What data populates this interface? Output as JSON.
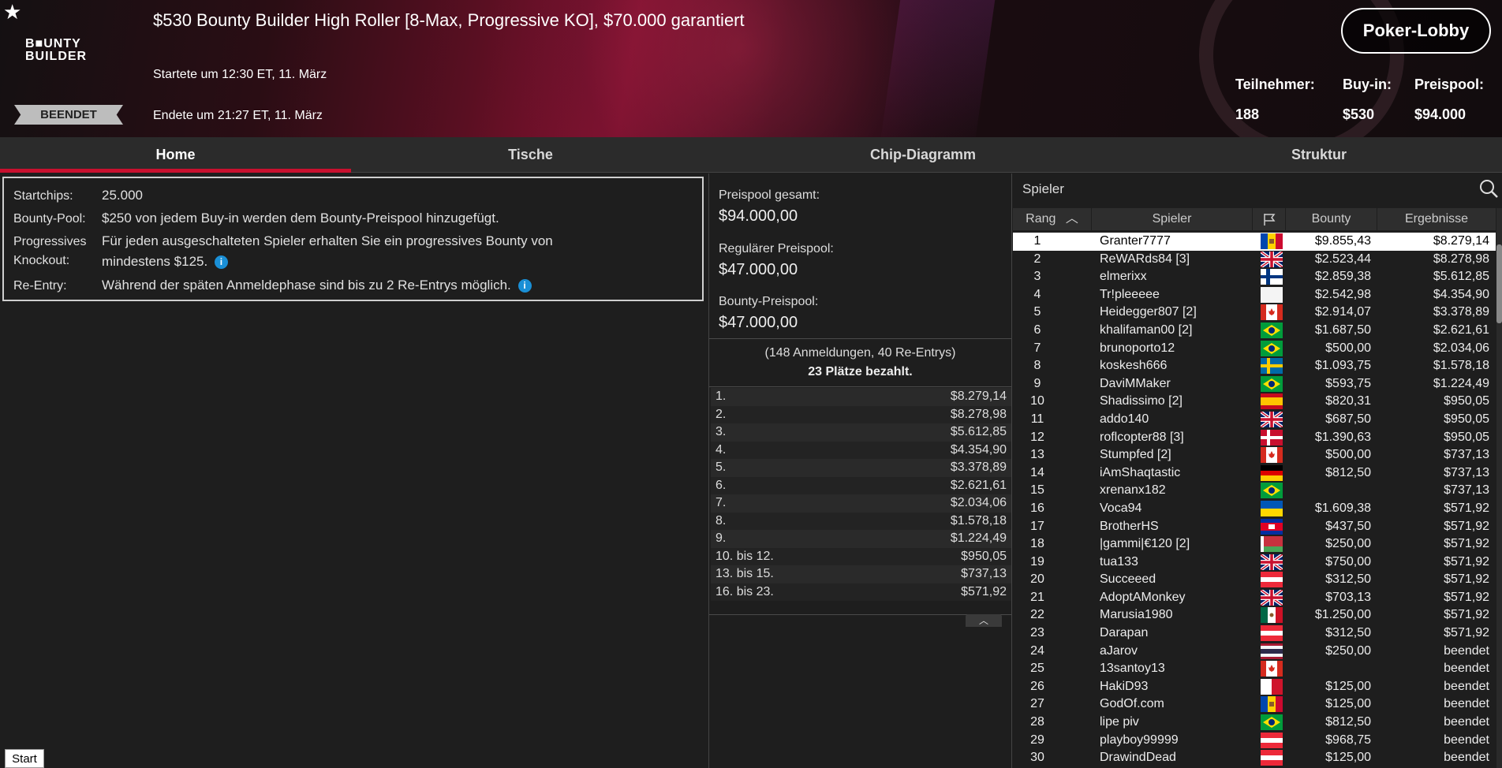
{
  "header": {
    "logo_line1": "B■UNTY",
    "logo_line2": "BUILDER",
    "status": "BEENDET",
    "title": "$530 Bounty Builder High Roller [8-Max, Progressive KO], $70.000 garantiert",
    "started": "Startete um 12:30 ET, 11. März",
    "ended": "Endete um 21:27 ET, 11. März",
    "lobby_button": "Poker-Lobby",
    "stats": {
      "players_label": "Teilnehmer:",
      "players_value": "188",
      "buyin_label": "Buy-in:",
      "buyin_value": "$530",
      "prizepool_label": "Preispool:",
      "prizepool_value": "$94.000"
    }
  },
  "tabs": [
    "Home",
    "Tische",
    "Chip-Diagramm",
    "Struktur"
  ],
  "info": {
    "startchips_label": "Startchips:",
    "startchips_value": "25.000",
    "bountypool_label": "Bounty-Pool:",
    "bountypool_value": "$250 von jedem Buy-in werden dem Bounty-Preispool hinzugefügt.",
    "pko_label_1": "Progressives",
    "pko_label_2": "Knockout:",
    "pko_value_1": "Für jeden ausgeschalteten Spieler erhalten Sie ein progressives Bounty von",
    "pko_value_2": "mindestens $125.",
    "reentry_label": "Re-Entry:",
    "reentry_value": "Während der späten Anmeldephase sind bis zu 2 Re-Entrys möglich."
  },
  "prize": {
    "total_label": "Preispool gesamt:",
    "total_value": "$94.000,00",
    "regular_label": "Regulärer Preispool:",
    "regular_value": "$47.000,00",
    "bounty_label": "Bounty-Preispool:",
    "bounty_value": "$47.000,00",
    "entries": "(148 Anmeldungen, 40 Re-Entrys)",
    "paid": "23 Plätze bezahlt.",
    "payouts": [
      {
        "place": "1.",
        "amount": "$8.279,14"
      },
      {
        "place": "2.",
        "amount": "$8.278,98"
      },
      {
        "place": "3.",
        "amount": "$5.612,85"
      },
      {
        "place": "4.",
        "amount": "$4.354,90"
      },
      {
        "place": "5.",
        "amount": "$3.378,89"
      },
      {
        "place": "6.",
        "amount": "$2.621,61"
      },
      {
        "place": "7.",
        "amount": "$2.034,06"
      },
      {
        "place": "8.",
        "amount": "$1.578,18"
      },
      {
        "place": "9.",
        "amount": "$1.224,49"
      },
      {
        "place": "10. bis 12.",
        "amount": "$950,05"
      },
      {
        "place": "13. bis 15.",
        "amount": "$737,13"
      },
      {
        "place": "16. bis 23.",
        "amount": "$571,92"
      }
    ]
  },
  "players": {
    "search_label": "Spieler",
    "columns": {
      "rank": "Rang",
      "player": "Spieler",
      "bounty": "Bounty",
      "results": "Ergebnisse"
    },
    "rows": [
      {
        "rank": "1",
        "name": "Granter7777",
        "flag": "moldova",
        "bounty": "$9.855,43",
        "result": "$8.279,14"
      },
      {
        "rank": "2",
        "name": "ReWARds84 [3]",
        "flag": "uk",
        "bounty": "$2.523,44",
        "result": "$8.278,98"
      },
      {
        "rank": "3",
        "name": "elmerixx",
        "flag": "finland",
        "bounty": "$2.859,38",
        "result": "$5.612,85"
      },
      {
        "rank": "4",
        "name": "Tr!pleeeee",
        "flag": "white",
        "bounty": "$2.542,98",
        "result": "$4.354,90"
      },
      {
        "rank": "5",
        "name": "Heidegger807 [2]",
        "flag": "canada",
        "bounty": "$2.914,07",
        "result": "$3.378,89"
      },
      {
        "rank": "6",
        "name": "khalifaman00 [2]",
        "flag": "brazil",
        "bounty": "$1.687,50",
        "result": "$2.621,61"
      },
      {
        "rank": "7",
        "name": "brunoporto12",
        "flag": "brazil",
        "bounty": "$500,00",
        "result": "$2.034,06"
      },
      {
        "rank": "8",
        "name": "koskesh666",
        "flag": "sweden",
        "bounty": "$1.093,75",
        "result": "$1.578,18"
      },
      {
        "rank": "9",
        "name": "DaviMMaker",
        "flag": "brazil",
        "bounty": "$593,75",
        "result": "$1.224,49"
      },
      {
        "rank": "10",
        "name": "Shadissimo [2]",
        "flag": "spain",
        "bounty": "$820,31",
        "result": "$950,05"
      },
      {
        "rank": "11",
        "name": "addo140",
        "flag": "uk",
        "bounty": "$687,50",
        "result": "$950,05"
      },
      {
        "rank": "12",
        "name": "roflcopter88 [3]",
        "flag": "denmark",
        "bounty": "$1.390,63",
        "result": "$950,05"
      },
      {
        "rank": "13",
        "name": "Stumpfed [2]",
        "flag": "canada",
        "bounty": "$500,00",
        "result": "$737,13"
      },
      {
        "rank": "14",
        "name": "iAmShaqtastic",
        "flag": "germany",
        "bounty": "$812,50",
        "result": "$737,13"
      },
      {
        "rank": "15",
        "name": "xrenanx182",
        "flag": "brazil",
        "bounty": "",
        "result": "$737,13"
      },
      {
        "rank": "16",
        "name": "Voca94",
        "flag": "ukraine",
        "bounty": "$1.609,38",
        "result": "$571,92"
      },
      {
        "rank": "17",
        "name": "BrotherHS",
        "flag": "cambodia",
        "bounty": "$437,50",
        "result": "$571,92"
      },
      {
        "rank": "18",
        "name": "|gammi|€120 [2]",
        "flag": "belarus",
        "bounty": "$250,00",
        "result": "$571,92"
      },
      {
        "rank": "19",
        "name": "tua133",
        "flag": "uk",
        "bounty": "$750,00",
        "result": "$571,92"
      },
      {
        "rank": "20",
        "name": "Succeeed",
        "flag": "austria",
        "bounty": "$312,50",
        "result": "$571,92"
      },
      {
        "rank": "21",
        "name": "AdoptAMonkey",
        "flag": "uk",
        "bounty": "$703,13",
        "result": "$571,92"
      },
      {
        "rank": "22",
        "name": "Marusia1980",
        "flag": "mexico",
        "bounty": "$1.250,00",
        "result": "$571,92"
      },
      {
        "rank": "23",
        "name": "Darapan",
        "flag": "austria",
        "bounty": "$312,50",
        "result": "$571,92"
      },
      {
        "rank": "24",
        "name": "aJarov",
        "flag": "thailand",
        "bounty": "$250,00",
        "result": "beendet"
      },
      {
        "rank": "25",
        "name": "13santoy13",
        "flag": "canada",
        "bounty": "",
        "result": "beendet"
      },
      {
        "rank": "26",
        "name": "HakiD93",
        "flag": "malta",
        "bounty": "$125,00",
        "result": "beendet"
      },
      {
        "rank": "27",
        "name": "GodOf.com",
        "flag": "moldova",
        "bounty": "$125,00",
        "result": "beendet"
      },
      {
        "rank": "28",
        "name": "lipe piv",
        "flag": "brazil",
        "bounty": "$812,50",
        "result": "beendet"
      },
      {
        "rank": "29",
        "name": "playboy99999",
        "flag": "austria",
        "bounty": "$968,75",
        "result": "beendet"
      },
      {
        "rank": "30",
        "name": "DrawindDead",
        "flag": "austria",
        "bounty": "$125,00",
        "result": "beendet"
      }
    ]
  },
  "taskbar": {
    "start": "Start"
  }
}
